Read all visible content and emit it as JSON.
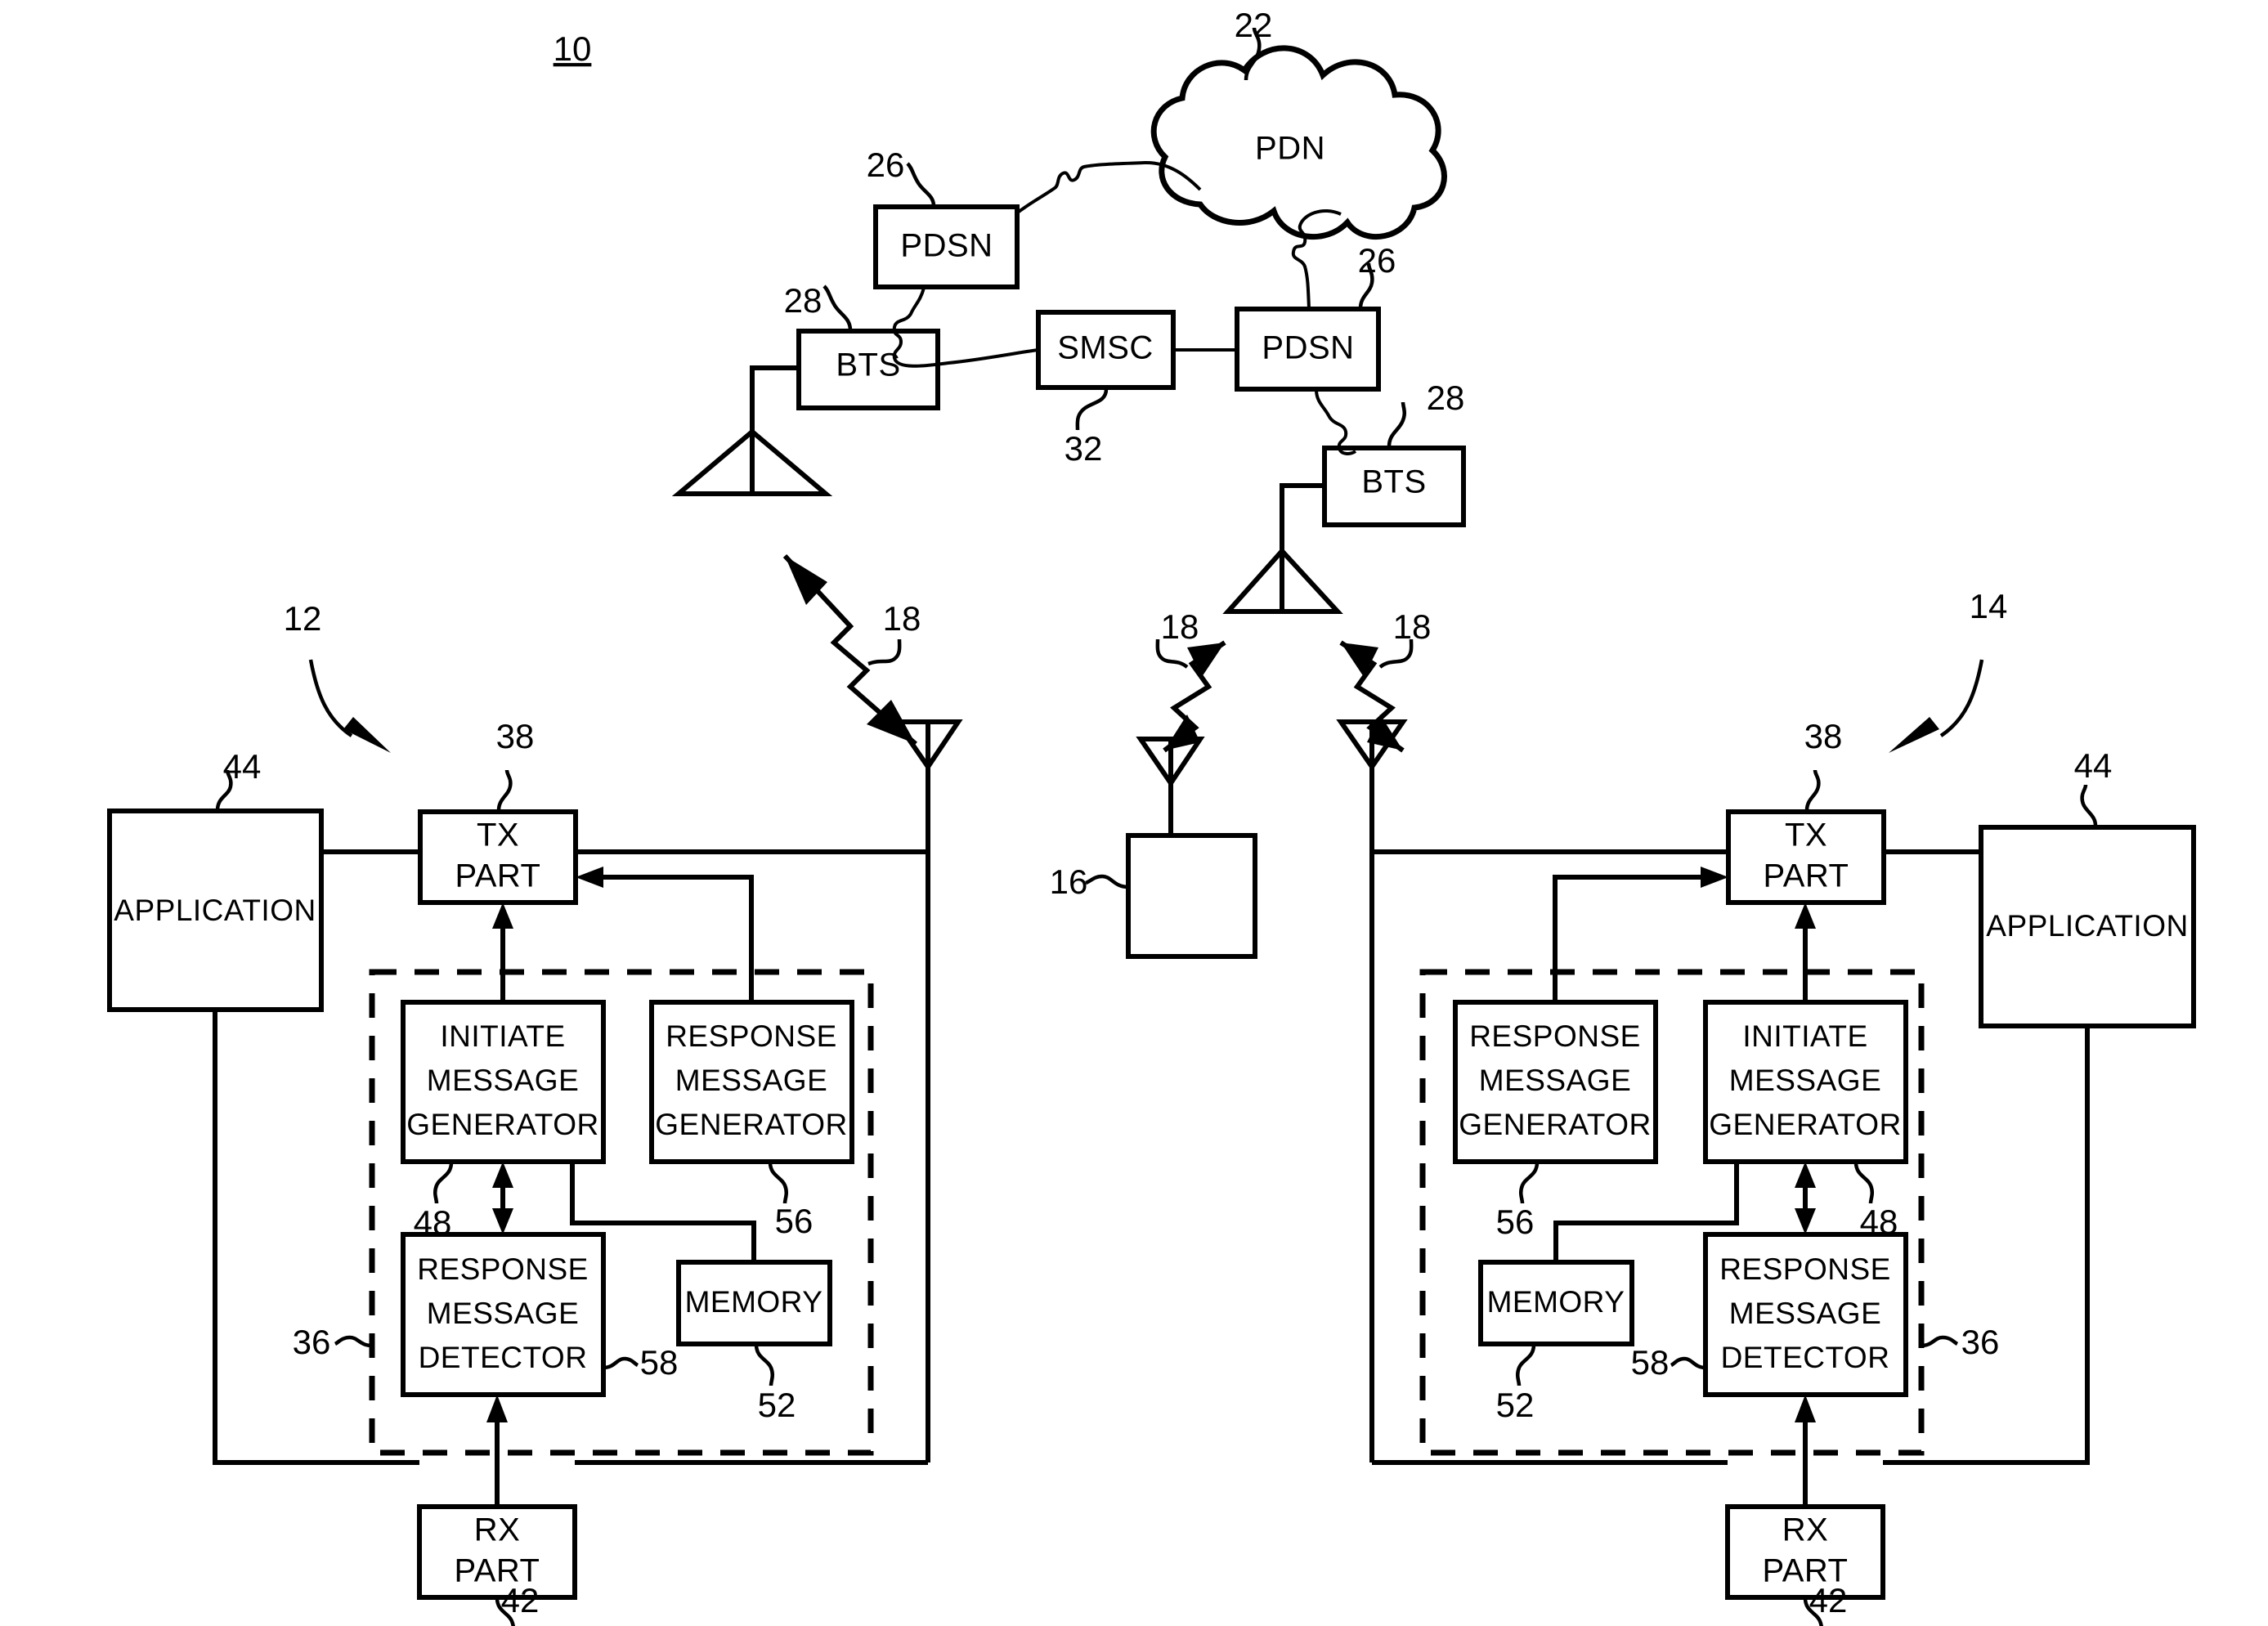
{
  "figure": {
    "number": "10",
    "type": "patent-block-diagram",
    "title_text": "10"
  },
  "network": {
    "cloud": {
      "label": "PDN",
      "ref": "22"
    },
    "nodes": [
      {
        "id": "pdsn-left",
        "label": "PDSN",
        "ref": "26"
      },
      {
        "id": "pdsn-right",
        "label": "PDSN",
        "ref": "26"
      },
      {
        "id": "smsc",
        "label": "SMSC",
        "ref": "32"
      },
      {
        "id": "bts-left",
        "label": "BTS",
        "ref": "28"
      },
      {
        "id": "bts-right",
        "label": "BTS",
        "ref": "28"
      }
    ],
    "air_link_refs": [
      "18",
      "18",
      "18",
      "18"
    ]
  },
  "center_terminal": {
    "ref": "16",
    "label": ""
  },
  "devices": [
    {
      "id": "device-left",
      "ref": "12",
      "application": {
        "label": "APPLICATION",
        "ref": "44"
      },
      "tx": {
        "label_line1": "TX",
        "label_line2": "PART",
        "ref": "38"
      },
      "rx": {
        "label_line1": "RX",
        "label_line2": "PART",
        "ref": "42"
      },
      "controller": {
        "ref": "36"
      },
      "blocks": [
        {
          "id": "initiate-message-generator",
          "lines": [
            "INITIATE",
            "MESSAGE",
            "GENERATOR"
          ],
          "ref": "48"
        },
        {
          "id": "response-message-generator",
          "lines": [
            "RESPONSE",
            "MESSAGE",
            "GENERATOR"
          ],
          "ref": "56"
        },
        {
          "id": "response-message-detector",
          "lines": [
            "RESPONSE",
            "MESSAGE",
            "DETECTOR"
          ],
          "ref": "58"
        },
        {
          "id": "memory",
          "lines": [
            "MEMORY"
          ],
          "ref": "52"
        }
      ]
    },
    {
      "id": "device-right",
      "ref": "14",
      "application": {
        "label": "APPLICATION",
        "ref": "44"
      },
      "tx": {
        "label_line1": "TX",
        "label_line2": "PART",
        "ref": "38"
      },
      "rx": {
        "label_line1": "RX",
        "label_line2": "PART",
        "ref": "42"
      },
      "controller": {
        "ref": "36"
      },
      "blocks": [
        {
          "id": "response-message-generator",
          "lines": [
            "RESPONSE",
            "MESSAGE",
            "GENERATOR"
          ],
          "ref": "56"
        },
        {
          "id": "initiate-message-generator",
          "lines": [
            "INITIATE",
            "MESSAGE",
            "GENERATOR"
          ],
          "ref": "48"
        },
        {
          "id": "memory",
          "lines": [
            "MEMORY"
          ],
          "ref": "52"
        },
        {
          "id": "response-message-detector",
          "lines": [
            "RESPONSE",
            "MESSAGE",
            "DETECTOR"
          ],
          "ref": "58"
        }
      ]
    }
  ],
  "colors": {
    "ink": "#000000",
    "paper": "#ffffff"
  }
}
